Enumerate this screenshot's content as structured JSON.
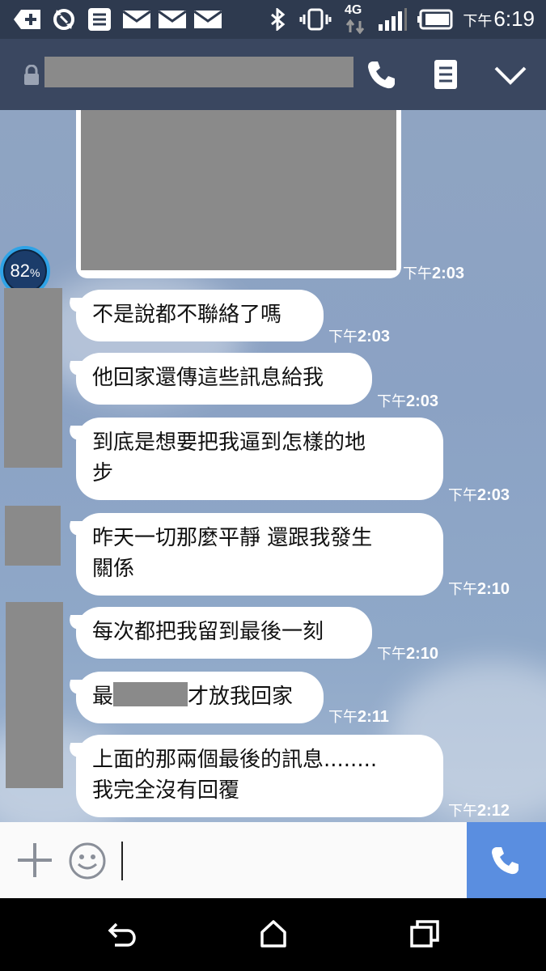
{
  "status_bar": {
    "time_prefix": "下午",
    "time": "6:19",
    "network": "4G",
    "icons": [
      "plus-box-icon",
      "sync-icon",
      "notes-icon",
      "mail-icon",
      "mail-icon",
      "mail-icon",
      "bluetooth-icon",
      "vibrate-icon",
      "signal-icon",
      "battery-icon"
    ]
  },
  "header": {
    "icons": [
      "lock-icon",
      "phone-icon",
      "notes-icon",
      "chevron-down-icon"
    ]
  },
  "battery_widget": {
    "percent": "82",
    "percent_unit": "%"
  },
  "messages": [
    {
      "text": "",
      "time_prefix": "下午",
      "time": "2:03"
    },
    {
      "text": "不是說都不聯絡了嗎",
      "time_prefix": "下午",
      "time": "2:03"
    },
    {
      "text": "他回家還傳這些訊息給我",
      "time_prefix": "下午",
      "time": "2:03"
    },
    {
      "text": "到底是想要把我逼到怎樣的地步",
      "line1": "到底是想要把我逼到怎樣的地",
      "line2": "步",
      "time_prefix": "下午",
      "time": "2:03"
    },
    {
      "text": "昨天一切那麼平靜 還跟我發生關係",
      "line1": "昨天一切那麼平靜 還跟我發生",
      "line2": "關係",
      "time_prefix": "下午",
      "time": "2:10"
    },
    {
      "text": "每次都把我留到最後一刻",
      "time_prefix": "下午",
      "time": "2:10"
    },
    {
      "text_before": "最",
      "text_after": "才放我回家",
      "time_prefix": "下午",
      "time": "2:11"
    },
    {
      "line1": "上面的那兩個最後的訊息........",
      "line2": "我完全沒有回覆",
      "time_prefix": "下午",
      "time": "2:12"
    }
  ],
  "input_bar": {
    "icons": [
      "plus-icon",
      "emoji-icon",
      "phone-icon"
    ],
    "value": ""
  },
  "nav_bar": {
    "icons": [
      "back-icon",
      "home-icon",
      "recents-icon"
    ]
  }
}
